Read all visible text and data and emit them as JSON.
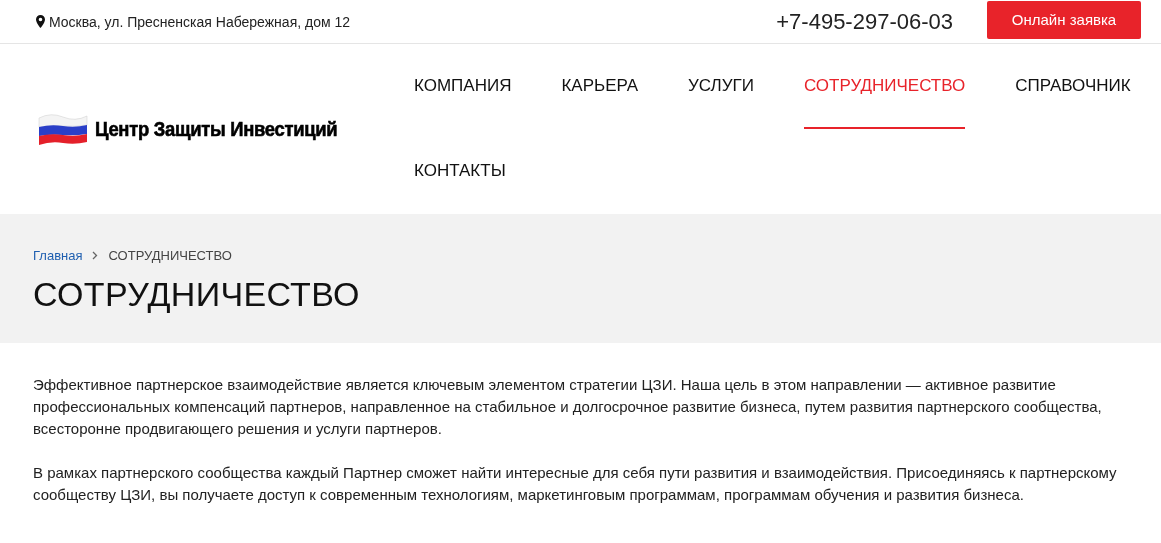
{
  "topbar": {
    "address": "Москва, ул. Пресненская Набережная, дом 12",
    "phone": "+7-495-297-06-03",
    "cta_button": "Онлайн заявка"
  },
  "header": {
    "logo_text": "Центр Защиты Инвестиций",
    "nav": [
      {
        "label": "КОМПАНИЯ",
        "selected": false
      },
      {
        "label": "КАРЬЕРА",
        "selected": false
      },
      {
        "label": "УСЛУГИ",
        "selected": false
      },
      {
        "label": "СОТРУДНИЧЕСТВО",
        "selected": true
      },
      {
        "label": "СПРАВОЧНИК",
        "selected": false
      },
      {
        "label": "КОНТАКТЫ",
        "selected": false
      }
    ]
  },
  "breadcrumbs": [
    {
      "label": "Главная",
      "kind": "link"
    },
    {
      "label": "СОТРУДНИЧЕСТВО",
      "kind": "current"
    }
  ],
  "page_title": "СОТРУДНИЧЕСТВО",
  "paragraphs": [
    "Эффективное партнерское взаимодействие является ключевым элементом стратегии ЦЗИ. Наша цель в этом направлении — активное развитие профессиональных компенсаций партнеров, направленное на стабильное и долгосрочное развитие бизнеса, путем развития партнерского сообщества, всесторонне продвигающего решения и услуги партнеров.",
    "В рамках партнерского сообщества каждый Партнер сможет найти интересные для себя пути развития и взаимодействия. Присоединяясь к партнерскому сообществу ЦЗИ, вы получаете доступ к современным технологиям, маркетинговым программам, программам обучения и развития бизнеса."
  ]
}
